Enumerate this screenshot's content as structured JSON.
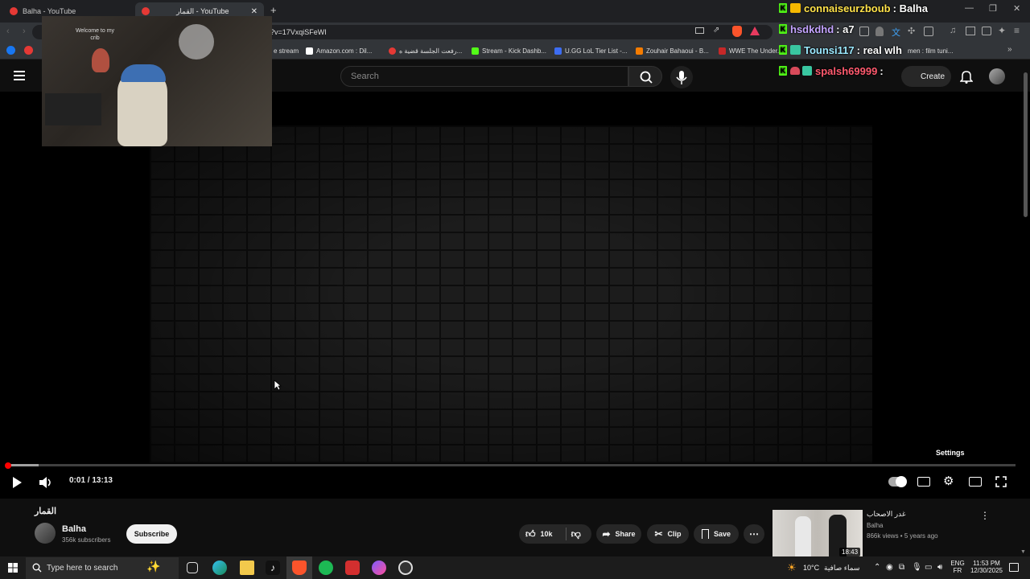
{
  "browser": {
    "tabs": [
      {
        "label": "Balha - YouTube",
        "active": false
      },
      {
        "label": "القمار - YouTube",
        "active": true
      }
    ],
    "new_tab": "+",
    "url": "?v=17VxqiSFeWI",
    "bookmarks": [
      {
        "label": "e stream"
      },
      {
        "label": "Amazon.com : Dil..."
      },
      {
        "label": "رفعت الجلسة قضية ه..."
      },
      {
        "label": "Stream - Kick Dashb..."
      },
      {
        "label": "U.GG LoL Tier List -..."
      },
      {
        "label": "Zouhair Bahaoui - B..."
      },
      {
        "label": "WWE The Under..."
      },
      {
        "label": "men : film tuni..."
      }
    ]
  },
  "youtube": {
    "search_placeholder": "Search",
    "create_label": "Create"
  },
  "webcam": {
    "sign_text": "Welcome to my crib"
  },
  "chat": [
    {
      "user": "connaiseurzboub",
      "message": ": Balha",
      "color": "#ffe24a"
    },
    {
      "user": "hsdkdhd",
      "message": ": a7",
      "color": "#c4a4ff"
    },
    {
      "user": "Tounsi117",
      "message": ": real wlh",
      "color": "#9be9ff"
    },
    {
      "user": "spalsh69999",
      "message": ":",
      "color": "#ff5a6e"
    }
  ],
  "player": {
    "time_current": "0:01",
    "time_separator": " / ",
    "time_total": "13:13",
    "progress_fraction": 0.0013,
    "settings_tooltip": "Settings"
  },
  "video": {
    "title": "القمار",
    "channel": "Balha",
    "subscribers": "356k subscribers",
    "subscribe_label": "Subscribe",
    "likes": "10k",
    "share_label": "Share",
    "clip_label": "Clip",
    "save_label": "Save"
  },
  "recommendation": {
    "title": "غدر الاصحاب",
    "channel": "Balha",
    "meta": "866k views • 5 years ago",
    "duration": "18:43"
  },
  "taskbar": {
    "search_placeholder": "Type here to search",
    "weather_temp": "10°C",
    "weather_desc": "سماء صافية",
    "lang_top": "ENG",
    "lang_bottom": "FR",
    "time": "11:53 PM",
    "date": "12/30/2025"
  }
}
